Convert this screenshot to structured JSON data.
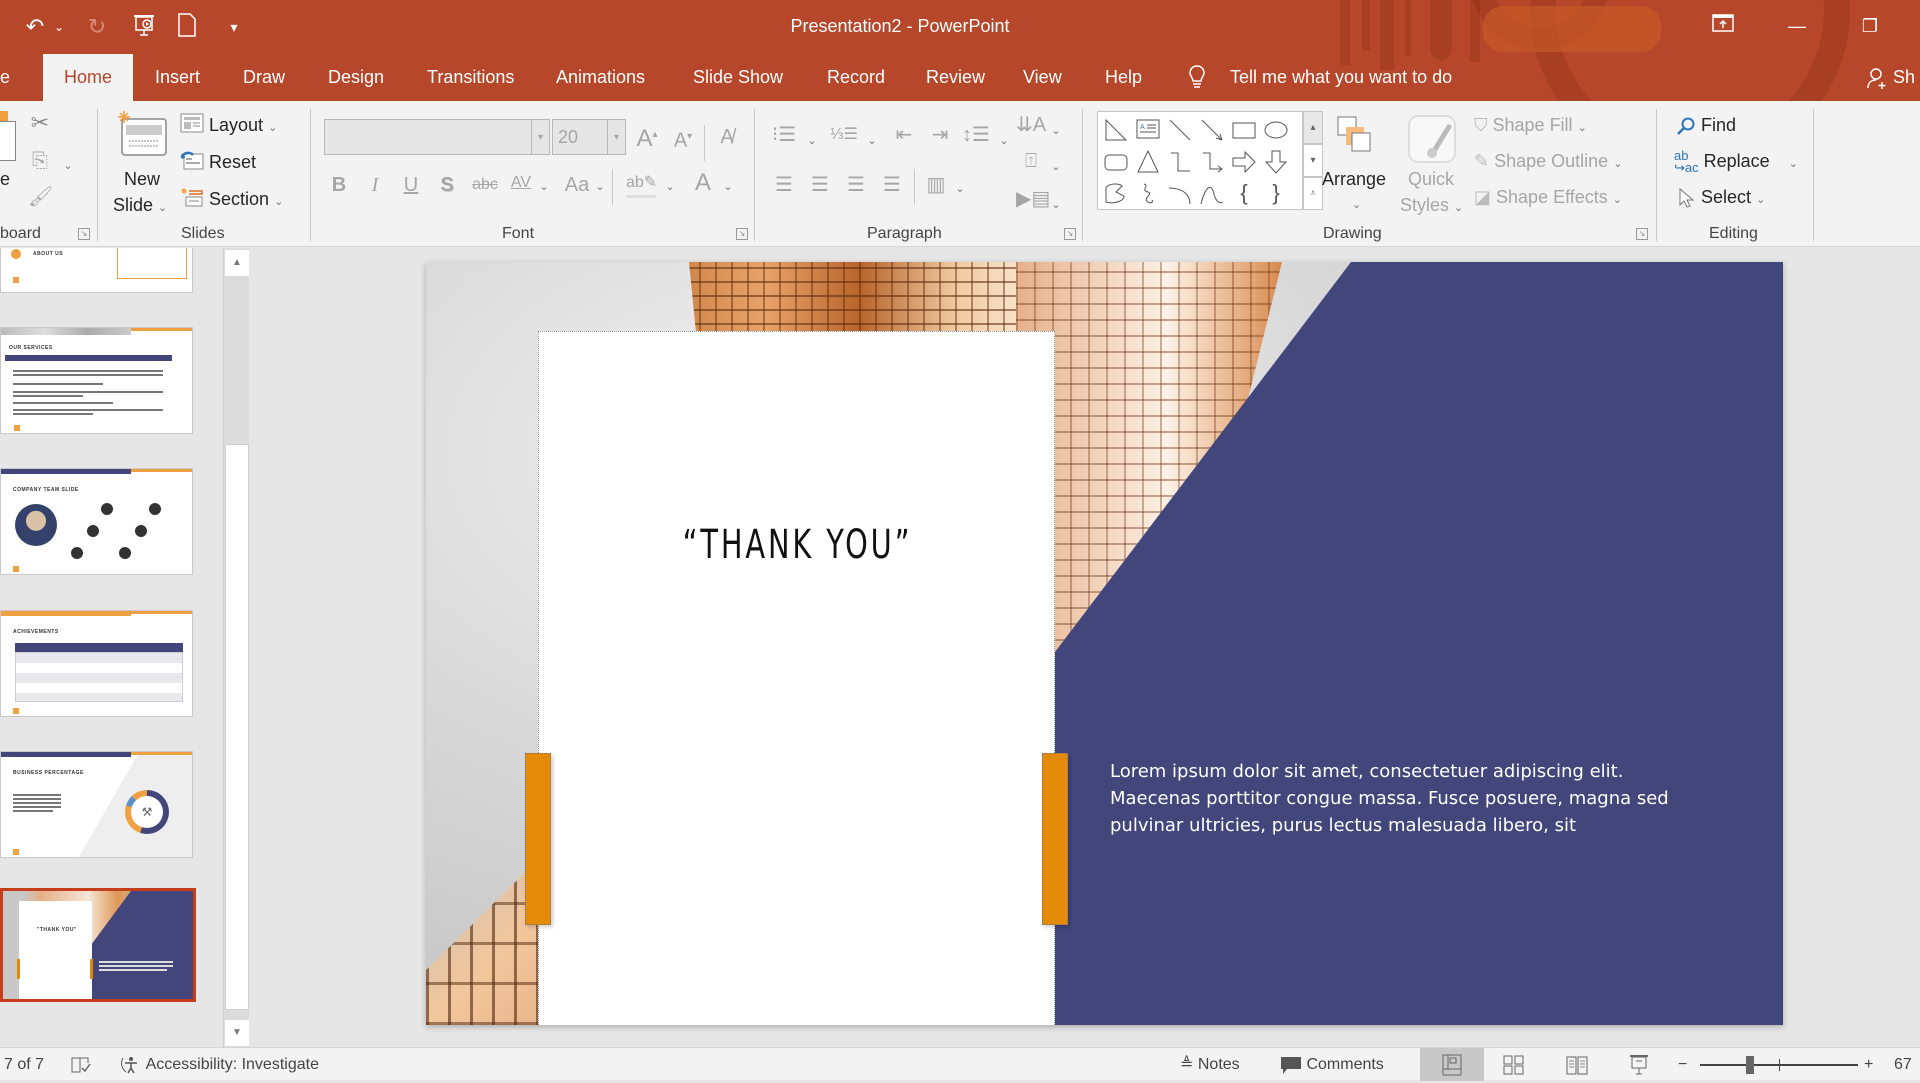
{
  "window": {
    "title": "Presentation2  -  PowerPoint",
    "controls": {
      "ribbon_display": "ribbon-display-options-icon",
      "minimize": "minimize-icon",
      "restore": "restore-icon"
    }
  },
  "quick_access": [
    {
      "name": "undo-icon",
      "glyph": "↶"
    },
    {
      "name": "undo-dropdown-icon",
      "glyph": "⌄"
    },
    {
      "name": "redo-icon",
      "glyph": "↻"
    },
    {
      "name": "start-from-beginning-icon",
      "glyph": "▣"
    },
    {
      "name": "new-file-icon",
      "glyph": "▯"
    },
    {
      "name": "customize-qat-icon",
      "glyph": "▾"
    }
  ],
  "tabs": [
    {
      "label": "e"
    },
    {
      "label": "Home",
      "active": true
    },
    {
      "label": "Insert"
    },
    {
      "label": "Draw"
    },
    {
      "label": "Design"
    },
    {
      "label": "Transitions"
    },
    {
      "label": "Animations"
    },
    {
      "label": "Slide Show"
    },
    {
      "label": "Record"
    },
    {
      "label": "Review"
    },
    {
      "label": "View"
    },
    {
      "label": "Help"
    }
  ],
  "tell_me": "Tell me what you want to do",
  "share": "Sh",
  "ribbon": {
    "clipboard": {
      "label": "board",
      "paste": "e"
    },
    "slides": {
      "label": "Slides",
      "new_slide_1": "New",
      "new_slide_2": "Slide",
      "layout": "Layout",
      "reset": "Reset",
      "section": "Section"
    },
    "font": {
      "label": "Font",
      "font_name": "",
      "font_size": "20",
      "buttons": [
        "B",
        "I",
        "U",
        "S",
        "abc",
        "AV",
        "Aa",
        "A",
        "A"
      ]
    },
    "paragraph": {
      "label": "Paragraph"
    },
    "drawing": {
      "label": "Drawing",
      "arrange": "Arrange",
      "quick_styles_1": "Quick",
      "quick_styles_2": "Styles",
      "shape_fill": "Shape Fill",
      "shape_outline": "Shape Outline",
      "shape_effects": "Shape Effects"
    },
    "editing": {
      "label": "Editing",
      "find": "Find",
      "replace": "Replace",
      "select": "Select"
    }
  },
  "thumbnails": [
    {
      "index": 2,
      "title": "ABOUT US"
    },
    {
      "index": 3,
      "title": "OUR SERVICES"
    },
    {
      "index": 4,
      "title": "COMPANY TEAM SLIDE"
    },
    {
      "index": 5,
      "title": "ACHIEVEMENTS"
    },
    {
      "index": 6,
      "title": "BUSINESS PERCENTAGE"
    },
    {
      "index": 7,
      "title": "\"THANK YOU\"",
      "selected": true
    }
  ],
  "slide": {
    "title": "“THANK YOU”",
    "body": "Lorem ipsum dolor sit amet, consectetuer adipiscing elit. Maecenas porttitor congue massa. Fusce posuere, magna sed pulvinar ultricies, purus lectus malesuada libero, sit",
    "colors": {
      "panel": "#43467b",
      "accent": "#e38a08"
    }
  },
  "status": {
    "slide_counter": "7 of 7",
    "accessibility": "Accessibility: Investigate",
    "notes": "Notes",
    "comments": "Comments",
    "zoom": "67",
    "zoom_minus": "−",
    "zoom_plus": "+"
  },
  "theme": {
    "accent": "#b7472a",
    "selected_thumb": "#c43e1c"
  }
}
